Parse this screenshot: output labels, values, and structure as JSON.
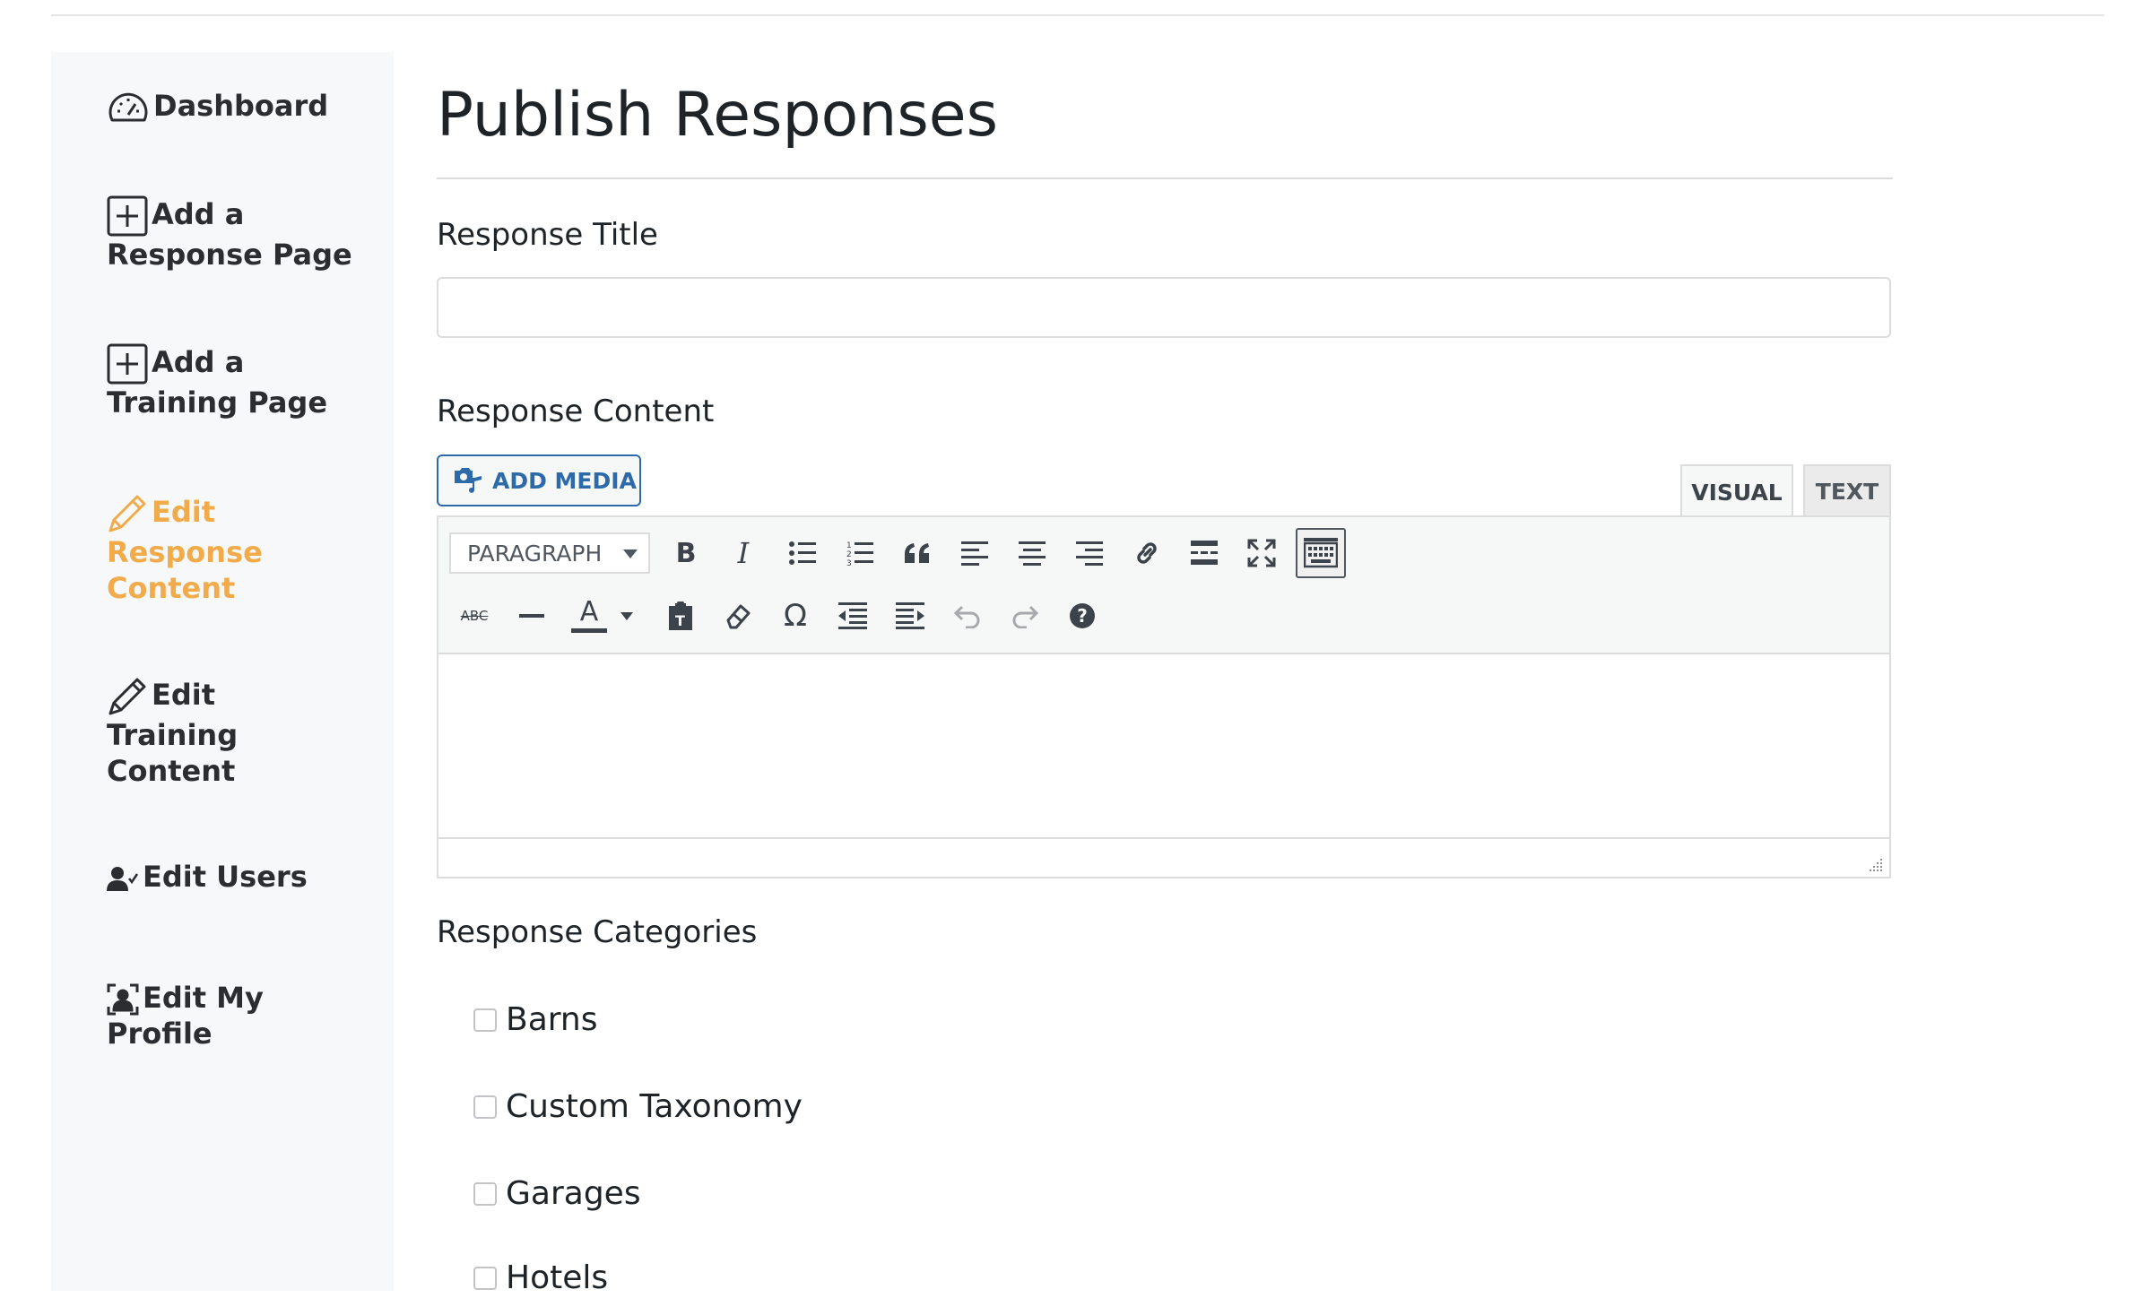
{
  "sidebar": {
    "items": [
      {
        "label": "Dashboard",
        "icon": "dashboard-gauge-icon"
      },
      {
        "label_line1": "Add a",
        "label_line2": "Response Page",
        "icon": "plus-square-icon"
      },
      {
        "label_line1": "Add a",
        "label_line2": "Training Page",
        "icon": "plus-square-icon"
      },
      {
        "label_line1": "Edit",
        "label_line2": "Response",
        "label_line3": "Content",
        "icon": "pencil-icon",
        "active": true
      },
      {
        "label_line1": "Edit",
        "label_line2": "Training",
        "label_line3": "Content",
        "icon": "pencil-icon"
      },
      {
        "label": "Edit Users",
        "icon": "user-check-icon"
      },
      {
        "label_line1": "Edit My",
        "label_line2": "Profile",
        "icon": "profile-card-icon"
      }
    ],
    "active_color": "#f2ab4a"
  },
  "main": {
    "title": "Publish Responses",
    "response_title": {
      "label": "Response Title",
      "value": "",
      "placeholder": ""
    },
    "response_content": {
      "label": "Response Content",
      "add_media_label": "ADD MEDIA",
      "tabs": {
        "visual": "VISUAL",
        "text": "TEXT"
      },
      "toolbar": {
        "format_value": "PARAGRAPH",
        "row1_icons": [
          "bold-icon",
          "italic-icon",
          "bullet-list-icon",
          "numbered-list-icon",
          "blockquote-icon",
          "align-left-icon",
          "align-center-icon",
          "align-right-icon",
          "link-icon",
          "read-more-icon",
          "fullscreen-icon",
          "toolbar-toggle-icon"
        ],
        "row2_icons": [
          "strikethrough-icon",
          "horizontal-line-icon",
          "text-color-icon",
          "paste-text-icon",
          "clear-formatting-icon",
          "special-character-icon",
          "outdent-icon",
          "indent-icon",
          "undo-icon",
          "redo-icon",
          "help-icon"
        ],
        "strikethrough_glyph": "ABC",
        "text_color_glyph": "A",
        "omega_glyph": "Ω",
        "bold_glyph": "B",
        "italic_glyph": "I"
      }
    },
    "response_categories": {
      "label": "Response Categories",
      "items": [
        "Barns",
        "Custom Taxonomy",
        "Garages",
        "Hotels"
      ]
    }
  },
  "colors": {
    "link_blue": "#2c6aa9",
    "text_dark": "#1d2327"
  }
}
